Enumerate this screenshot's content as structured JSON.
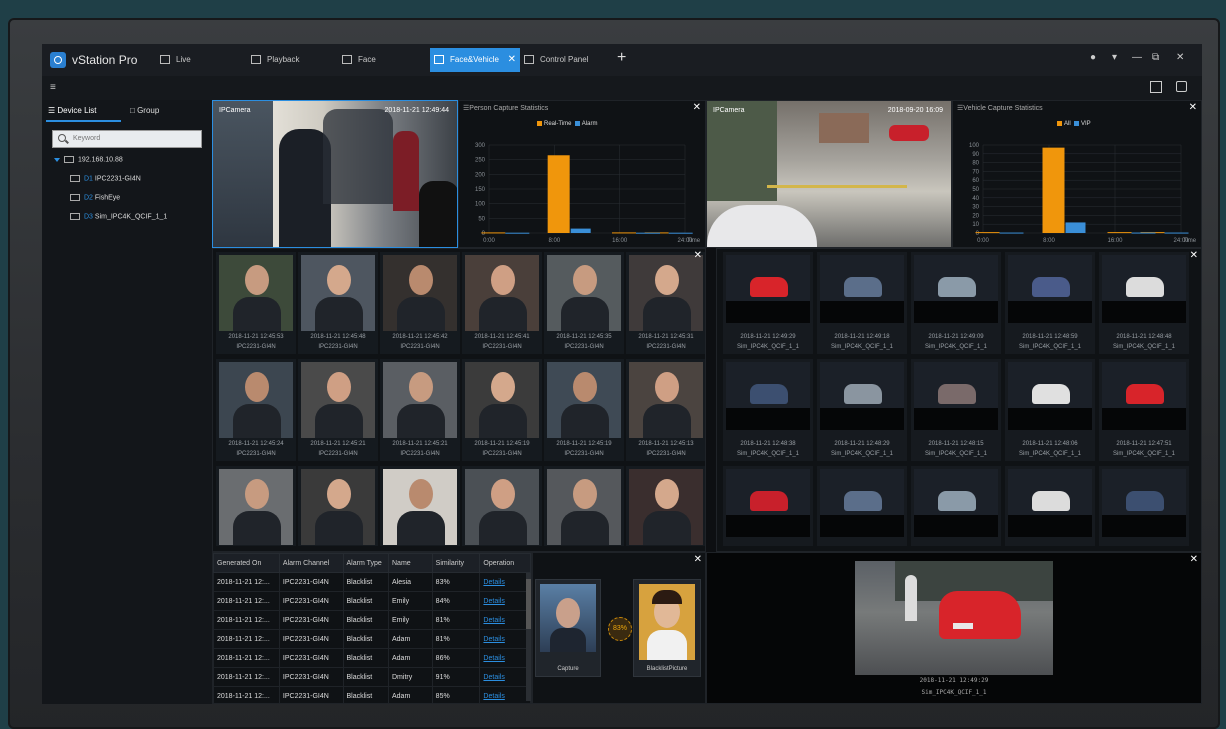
{
  "app": {
    "name": "vStation Pro"
  },
  "tabs": [
    {
      "label": "Live",
      "active": false
    },
    {
      "label": "Playback",
      "active": false
    },
    {
      "label": "Face",
      "active": false
    },
    {
      "label": "Face&Vehicle",
      "active": true
    },
    {
      "label": "Control Panel",
      "active": false
    }
  ],
  "sidebar": {
    "tab_device": "Device List",
    "tab_group": "Group",
    "search_placeholder": "Keyword",
    "root": "192.168.10.88",
    "devices": [
      {
        "id": "D1",
        "name": "IPC2231-GI4N"
      },
      {
        "id": "D2",
        "name": "FishEye"
      },
      {
        "id": "D3",
        "name": "Sim_IPC4K_QCIF_1_1"
      }
    ]
  },
  "live_face": {
    "label": "IPCamera",
    "time": "2018-11-21 12:49:44"
  },
  "live_vehicle": {
    "label": "IPCamera",
    "time": "2018-09-20 16:09"
  },
  "person_stats": {
    "title": "Person Capture Statistics",
    "legend": [
      "Real-Time",
      "Alarm"
    ],
    "colors": {
      "real_time": "#f0960c",
      "alarm": "#3a8fd8"
    },
    "chart_data": {
      "type": "bar",
      "x_ticks": [
        "0:00",
        "8:00",
        "16:00",
        "24:00"
      ],
      "x_unit": "Time",
      "y_ticks": [
        0,
        50,
        100,
        150,
        200,
        250,
        300
      ],
      "ylim": [
        0,
        300
      ],
      "series": [
        {
          "name": "Real-Time",
          "points": [
            {
              "x": 2,
              "y": 2
            },
            {
              "x": 10,
              "y": 265
            },
            {
              "x": 18,
              "y": 2
            },
            {
              "x": 22,
              "y": 2
            }
          ]
        },
        {
          "name": "Alarm",
          "points": [
            {
              "x": 2,
              "y": 1
            },
            {
              "x": 10,
              "y": 15
            },
            {
              "x": 18,
              "y": 1
            },
            {
              "x": 22,
              "y": 1
            }
          ]
        }
      ]
    }
  },
  "vehicle_stats": {
    "title": "Vehicle Capture Statistics",
    "legend": [
      "All",
      "VIP"
    ],
    "colors": {
      "all": "#f0960c",
      "vip": "#3a8fd8"
    },
    "chart_data": {
      "type": "bar",
      "x_ticks": [
        "0:00",
        "8:00",
        "16:00",
        "24:00"
      ],
      "x_unit": "Time",
      "y_ticks": [
        0,
        10,
        20,
        30,
        40,
        50,
        60,
        70,
        80,
        90,
        100
      ],
      "ylim": [
        0,
        100
      ],
      "series": [
        {
          "name": "All",
          "points": [
            {
              "x": 2,
              "y": 1
            },
            {
              "x": 10,
              "y": 97
            },
            {
              "x": 18,
              "y": 1
            },
            {
              "x": 22,
              "y": 1
            }
          ]
        },
        {
          "name": "VIP",
          "points": [
            {
              "x": 2,
              "y": 0.5
            },
            {
              "x": 10,
              "y": 12
            },
            {
              "x": 18,
              "y": 0.5
            },
            {
              "x": 22,
              "y": 0.5
            }
          ]
        }
      ]
    }
  },
  "faces": [
    {
      "time": "2018-11-21 12:45:53",
      "cam": "IPC2231-GI4N"
    },
    {
      "time": "2018-11-21 12:45:48",
      "cam": "IPC2231-GI4N"
    },
    {
      "time": "2018-11-21 12:45:42",
      "cam": "IPC2231-GI4N"
    },
    {
      "time": "2018-11-21 12:45:41",
      "cam": "IPC2231-GI4N"
    },
    {
      "time": "2018-11-21 12:45:35",
      "cam": "IPC2231-GI4N"
    },
    {
      "time": "2018-11-21 12:45:31",
      "cam": "IPC2231-GI4N"
    },
    {
      "time": "2018-11-21 12:45:24",
      "cam": "IPC2231-GI4N"
    },
    {
      "time": "2018-11-21 12:45:21",
      "cam": "IPC2231-GI4N"
    },
    {
      "time": "2018-11-21 12:45:21",
      "cam": "IPC2231-GI4N"
    },
    {
      "time": "2018-11-21 12:45:19",
      "cam": "IPC2231-GI4N"
    },
    {
      "time": "2018-11-21 12:45:19",
      "cam": "IPC2231-GI4N"
    },
    {
      "time": "2018-11-21 12:45:13",
      "cam": "IPC2231-GI4N"
    }
  ],
  "vehicles": [
    {
      "time": "2018-11-21 12:49:29",
      "cam": "Sim_IPC4K_QCIF_1_1"
    },
    {
      "time": "2018-11-21 12:49:18",
      "cam": "Sim_IPC4K_QCIF_1_1"
    },
    {
      "time": "2018-11-21 12:49:09",
      "cam": "Sim_IPC4K_QCIF_1_1"
    },
    {
      "time": "2018-11-21 12:48:59",
      "cam": "Sim_IPC4K_QCIF_1_1"
    },
    {
      "time": "2018-11-21 12:48:48",
      "cam": "Sim_IPC4K_QCIF_1_1"
    },
    {
      "time": "2018-11-21 12:48:38",
      "cam": "Sim_IPC4K_QCIF_1_1"
    },
    {
      "time": "2018-11-21 12:48:29",
      "cam": "Sim_IPC4K_QCIF_1_1"
    },
    {
      "time": "2018-11-21 12:48:15",
      "cam": "Sim_IPC4K_QCIF_1_1"
    },
    {
      "time": "2018-11-21 12:48:06",
      "cam": "Sim_IPC4K_QCIF_1_1"
    },
    {
      "time": "2018-11-21 12:47:51",
      "cam": "Sim_IPC4K_QCIF_1_1"
    }
  ],
  "alarms": {
    "headers": [
      "Generated On",
      "Alarm Channel",
      "Alarm Type",
      "Name",
      "Similarity",
      "Operation"
    ],
    "rows": [
      [
        "2018-11-21 12:...",
        "IPC2231-GI4N",
        "Blacklist",
        "Alesia",
        "83%",
        "Details"
      ],
      [
        "2018-11-21 12:...",
        "IPC2231-GI4N",
        "Blacklist",
        "Emily",
        "84%",
        "Details"
      ],
      [
        "2018-11-21 12:...",
        "IPC2231-GI4N",
        "Blacklist",
        "Emily",
        "81%",
        "Details"
      ],
      [
        "2018-11-21 12:...",
        "IPC2231-GI4N",
        "Blacklist",
        "Adam",
        "81%",
        "Details"
      ],
      [
        "2018-11-21 12:...",
        "IPC2231-GI4N",
        "Blacklist",
        "Adam",
        "86%",
        "Details"
      ],
      [
        "2018-11-21 12:...",
        "IPC2231-GI4N",
        "Blacklist",
        "Dmitry",
        "91%",
        "Details"
      ],
      [
        "2018-11-21 12:...",
        "IPC2231-GI4N",
        "Blacklist",
        "Adam",
        "85%",
        "Details"
      ]
    ]
  },
  "compare": {
    "capture_label": "Capture",
    "blacklist_label": "BlacklistPicture",
    "similarity": "83%"
  },
  "playback": {
    "time": "2018-11-21 12:49:29",
    "cam": "Sim_IPC4K_QCIF_1_1"
  }
}
